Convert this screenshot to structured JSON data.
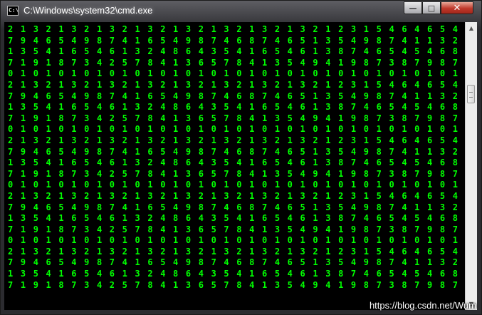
{
  "window": {
    "title": "C:\\Windows\\system32\\cmd.exe",
    "icon_label": "C:\\",
    "controls": {
      "minimize": "—",
      "maximize": "□",
      "close": "✕"
    }
  },
  "console": {
    "lines": [
      "2 1 3 2 1 3 2 1 3 2 1 3 2 1 3 2 1 3 2 1 3 2 1 3 2 1 2 3 1 5 4 6 4 6 5 4 6 5 4",
      "7 9 4 6 5 4 9 8 7 4 1 6 5 4 9 8 7 4 6 8 7 4 6 5 1 3 5 4 9 8 7 4 1 1 3 2 1 3 1",
      "1 3 5 4 1 6 5 4 6 1 3 2 4 8 6 4 3 5 4 1 6 5 4 6 1 3 8 7 4 6 5 4 5 4 6 8 1 3 5",
      "7 1 9 1 8 7 3 4 2 5 7 8 4 1 3 6 5 7 8 4 1 3 5 4 9 4 1 9 8 7 3 8 7 9 8 7 4 5 6",
      "0 1 0 1 0 1 0 1 0 1 0 1 0 1 0 1 0 1 0 1 0 1 0 1 0 1 0 1 0 1 0 1 0 1 0 1 0 1 0",
      "2 1 3 2 1 3 2 1 3 2 1 3 2 1 3 2 1 3 2 1 3 2 1 3 2 1 2 3 1 5 4 6 4 6 5 4 6 5 4",
      "7 9 4 6 5 4 9 8 7 4 1 6 5 4 9 8 7 4 6 8 7 4 6 5 1 3 5 4 9 8 7 4 1 1 3 2 1 3 1",
      "1 3 5 4 1 6 5 4 6 1 3 2 4 8 6 4 3 5 4 1 6 5 4 6 1 3 8 7 4 6 5 4 5 4 6 8 1 3 5",
      "7 1 9 1 8 7 3 4 2 5 7 8 4 1 3 6 5 7 8 4 1 3 5 4 9 4 1 9 8 7 3 8 7 9 8 7 4 5 6",
      "0 1 0 1 0 1 0 1 0 1 0 1 0 1 0 1 0 1 0 1 0 1 0 1 0 1 0 1 0 1 0 1 0 1 0 1 0 1 0",
      "2 1 3 2 1 3 2 1 3 2 1 3 2 1 3 2 1 3 2 1 3 2 1 3 2 1 2 3 1 5 4 6 4 6 5 4 6 5 4",
      "7 9 4 6 5 4 9 8 7 4 1 6 5 4 9 8 7 4 6 8 7 4 6 5 1 3 5 4 9 8 7 4 1 1 3 2 1 3 1",
      "1 3 5 4 1 6 5 4 6 1 3 2 4 8 6 4 3 5 4 1 6 5 4 6 1 3 8 7 4 6 5 4 5 4 6 8 1 3 5",
      "7 1 9 1 8 7 3 4 2 5 7 8 4 1 3 6 5 7 8 4 1 3 5 4 9 4 1 9 8 7 3 8 7 9 8 7 4 5 6",
      "0 1 0 1 0 1 0 1 0 1 0 1 0 1 0 1 0 1 0 1 0 1 0 1 0 1 0 1 0 1 0 1 0 1 0 1 0 1 0",
      "2 1 3 2 1 3 2 1 3 2 1 3 2 1 3 2 1 3 2 1 3 2 1 3 2 1 2 3 1 5 4 6 4 6 5 4 6 5 4",
      "7 9 4 6 5 4 9 8 7 4 1 6 5 4 9 8 7 4 6 8 7 4 6 5 1 3 5 4 9 8 7 4 1 1 3 2 1 3 1",
      "1 3 5 4 1 6 5 4 6 1 3 2 4 8 6 4 3 5 4 1 6 5 4 6 1 3 8 7 4 6 5 4 5 4 6 8 1 3 5",
      "7 1 9 1 8 7 3 4 2 5 7 8 4 1 3 6 5 7 8 4 1 3 5 4 9 4 1 9 8 7 3 8 7 9 8 7 4 5 6",
      "0 1 0 1 0 1 0 1 0 1 0 1 0 1 0 1 0 1 0 1 0 1 0 1 0 1 0 1 0 1 0 1 0 1 0 1 0 1 0",
      "2 1 3 2 1 3 2 1 3 2 1 3 2 1 3 2 1 3 2 1 3 2 1 3 2 1 2 3 1 5 4 6 4 6 5 4 6 5 4",
      "7 9 4 6 5 4 9 8 7 4 1 6 5 4 9 8 7 4 6 8 7 4 6 5 1 3 5 4 9 8 7 4 1 1 3 2 1 3 1",
      "1 3 5 4 1 6 5 4 6 1 3 2 4 8 6 4 3 5 4 1 6 5 4 6 1 3 8 7 4 6 5 4 5 4 6 8 1 3 5",
      "7 1 9 1 8 7 3 4 2 5 7 8 4 1 3 6 5 7 8 4 1 3 5 4 9 4 1 9 8 7 3 8 7 9 8 7 4 5 6"
    ],
    "text_color": "#00ff00",
    "background": "#000000"
  },
  "scrollbar": {
    "up_arrow": "▲",
    "down_arrow": "▼"
  },
  "watermark": "https://blog.csdn.net/Wum"
}
